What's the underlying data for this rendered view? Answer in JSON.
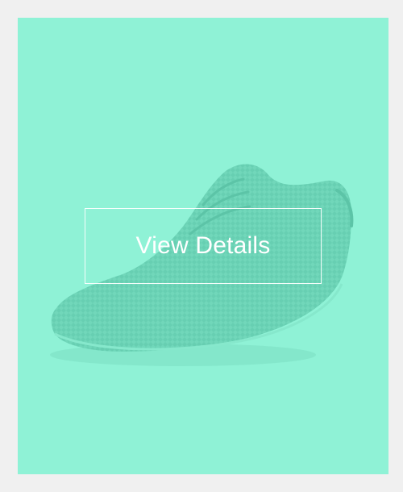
{
  "card": {
    "background_color": "#8ff2d6",
    "image_icon": "sneaker-icon",
    "button": {
      "label": "View Details"
    }
  },
  "page": {
    "background_color": "#f0f0f0"
  }
}
